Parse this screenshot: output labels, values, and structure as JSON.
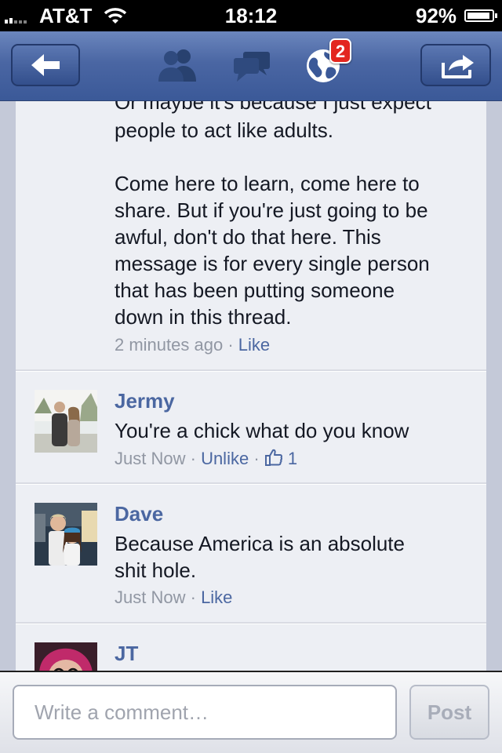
{
  "status_bar": {
    "carrier": "AT&T",
    "time": "18:12",
    "battery_percent": "92%",
    "battery_level": 0.92
  },
  "nav": {
    "back_icon": "back-arrow-icon",
    "friends_icon": "friend-requests-icon",
    "messages_icon": "messages-icon",
    "notifications_icon": "globe-notifications-icon",
    "notifications_badge": "2",
    "share_icon": "share-icon"
  },
  "thread": {
    "first_comment": {
      "cut_line": "Or maybe it's because I just expect",
      "text": "people to act like adults.\n\nCome here to learn, come here to\nshare. But if you're just going to be\nawful, don't do that here. This\nmessage is for every single person\nthat has been putting someone\ndown in this thread.",
      "time": "2 minutes ago",
      "like_label": "Like"
    },
    "comments": [
      {
        "name": "Jermy",
        "text": "You're a chick what do you know",
        "time": "Just Now",
        "action_label": "Unlike",
        "like_count": "1"
      },
      {
        "name": "Dave",
        "text": "Because America is an absolute\nshit hole.",
        "time": "Just Now",
        "action_label": "Like"
      },
      {
        "name": "JT"
      }
    ]
  },
  "composer": {
    "placeholder": "Write a comment…",
    "post_label": "Post"
  },
  "colors": {
    "facebook_blue": "#3b5998",
    "link_blue": "#4b67a1",
    "badge_red": "#e3261f",
    "content_bg": "#edeff4"
  }
}
